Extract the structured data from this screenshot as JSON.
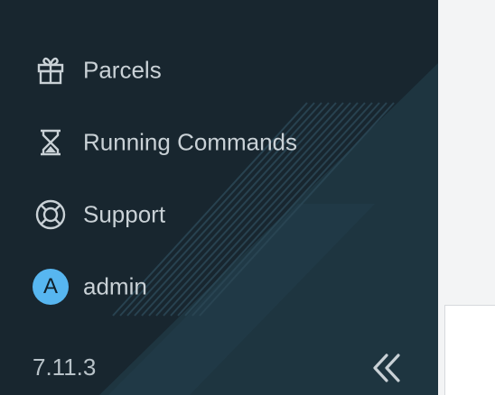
{
  "sidebar": {
    "items": [
      {
        "label": "Parcels",
        "icon": "gift-icon"
      },
      {
        "label": "Running Commands",
        "icon": "hourglass-icon"
      },
      {
        "label": "Support",
        "icon": "lifebuoy-icon"
      },
      {
        "label": "admin",
        "icon": "avatar",
        "avatar_letter": "A"
      }
    ],
    "version": "7.11.3",
    "collapse_icon": "double-chevron-left-icon"
  },
  "colors": {
    "sidebar_bg": "#18262f",
    "text": "#c9d1d6",
    "avatar_bg": "#57b6f0",
    "content_bg": "#f3f4f5"
  }
}
